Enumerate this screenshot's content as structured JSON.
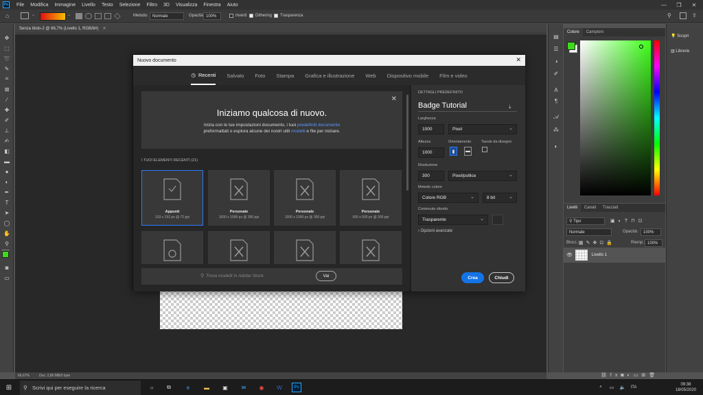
{
  "menubar": {
    "logo": "Ps",
    "items": [
      "File",
      "Modifica",
      "Immagine",
      "Livello",
      "Testo",
      "Selezione",
      "Filtro",
      "3D",
      "Visualizza",
      "Finestra",
      "Aiuto"
    ]
  },
  "options": {
    "method_label": "Metodo:",
    "method_value": "Normale",
    "opacity_label": "Opacità:",
    "opacity_value": "100%",
    "invert_label": "Inverti",
    "dither_label": "Dithering",
    "transparency_label": "Trasparenza"
  },
  "doc_tab": {
    "title": "Senza titolo-2 @ 66,7% (Livello 1, RGB/8#)"
  },
  "status": {
    "zoom": "66,67%",
    "doc": "Doc: 2,86 MB/0 byte"
  },
  "color_panel": {
    "tabs": [
      "Colore",
      "Campioni"
    ],
    "fg": "#3eda1a",
    "bg": "#ffffff"
  },
  "layers_panel": {
    "tabs": [
      "Livelli",
      "Canali",
      "Tracciati"
    ],
    "filter_value": "Tipo",
    "blend_value": "Normale",
    "opacity_label": "Opacità:",
    "opacity_value": "100%",
    "lock_label": "Blocc.:",
    "fill_label": "Riemp.:",
    "fill_value": "100%",
    "layer_name": "Livello 1"
  },
  "right_strip": {
    "items": [
      "Scopri",
      "Librerie"
    ]
  },
  "dialog": {
    "title": "Nuovo documento",
    "tabs": [
      "Recenti",
      "Salvato",
      "Foto",
      "Stampa",
      "Grafica e illustrazione",
      "Web",
      "Dispositivo mobile",
      "Film e video"
    ],
    "hero_title": "Iniziamo qualcosa di nuovo.",
    "hero_line1a": "Inizia con le tue impostazioni documento, i tuoi ",
    "hero_link1": "predefiniti documento",
    "hero_line2a": "preformattati o esplora alcune dei nostri utili ",
    "hero_link2": "modelli",
    "hero_line2b": " e file per iniziare.",
    "recent_label": "I TUOI ELEMENTI RECENTI  (21)",
    "cards": [
      {
        "name": "Appunti",
        "size": "103 x 192 px @ 72 ppi"
      },
      {
        "name": "Personale",
        "size": "1000 x 1000 px @ 300 ppi"
      },
      {
        "name": "Personale",
        "size": "1000 x 1000 px @ 300 ppi"
      },
      {
        "name": "Personale",
        "size": "500 x 500 px @ 300 ppi"
      }
    ],
    "search_placeholder": "Trova modelli in Adobe Stock",
    "search_button": "Vai",
    "details_label": "DETTAGLI PREDEFINITO",
    "preset_name": "Badge Tutorial",
    "width_label": "Larghezza",
    "width_value": "1000",
    "width_unit": "Pixel",
    "height_label": "Altezza",
    "height_value": "1000",
    "orientation_label": "Orientamento",
    "artboards_label": "Tavole da disegno",
    "resolution_label": "Risoluzione",
    "resolution_value": "300",
    "resolution_unit": "Pixel/pollice",
    "color_mode_label": "Metodo colore",
    "color_mode_value": "Colore RGB",
    "bit_value": "8 bit",
    "bg_label": "Contenuto sfondo",
    "bg_value": "Trasparente",
    "advanced_label": "Opzioni avanzate",
    "create_button": "Crea",
    "close_button": "Chiudi"
  },
  "taskbar": {
    "search_placeholder": "Scrivi qui per eseguire la ricerca",
    "time": "09:38",
    "date": "18/05/2020",
    "lang": "ITA"
  }
}
